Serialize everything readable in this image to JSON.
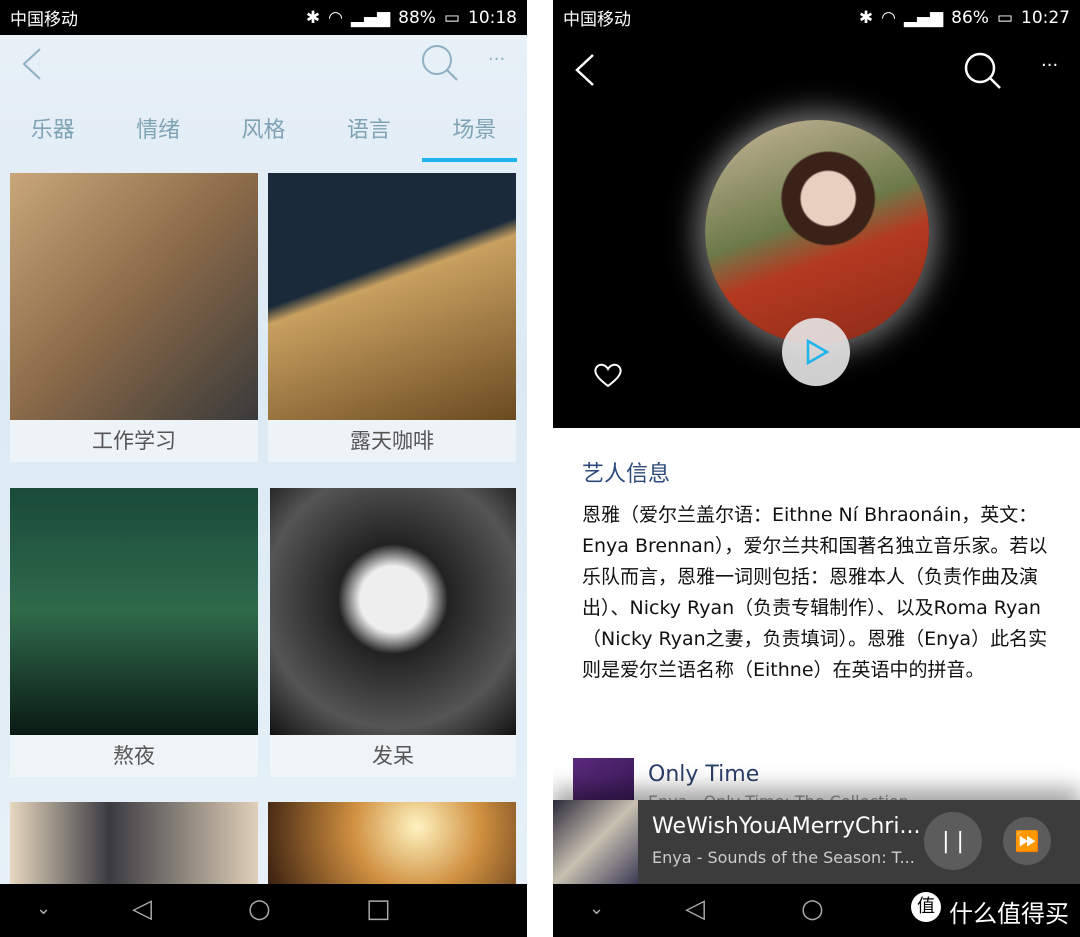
{
  "left": {
    "status": {
      "carrier": "中国移动",
      "battery": "88%",
      "time": "10:18"
    },
    "tabs": [
      {
        "label": "乐器"
      },
      {
        "label": "情绪"
      },
      {
        "label": "风格"
      },
      {
        "label": "语言"
      },
      {
        "label": "场景",
        "active": true
      }
    ],
    "tiles": [
      {
        "label": "工作学习"
      },
      {
        "label": "露天咖啡"
      },
      {
        "label": "熬夜"
      },
      {
        "label": "发呆"
      },
      {
        "label": ""
      },
      {
        "label": ""
      }
    ]
  },
  "right": {
    "status": {
      "carrier": "中国移动",
      "battery": "86%",
      "time": "10:27"
    },
    "artist_info": {
      "title": "艺人信息",
      "body": "恩雅（爱尔兰盖尔语：Eithne Ní Bhraonáin，英文：Enya Brennan），爱尔兰共和国著名独立音乐家。若以乐队而言，恩雅一词则包括：恩雅本人（负责作曲及演出）、Nicky Ryan（负责专辑制作）、以及Roma Ryan（Nicky Ryan之妻，负责填词）。恩雅（Enya）此名实则是爱尔兰语名称（Eithne）在英语中的拼音。"
    },
    "song": {
      "title": "Only Time",
      "subtitle": "Enya - Only Time: The Collection"
    },
    "mini_player": {
      "title": "WeWishYouAMerryChri...",
      "subtitle": "Enya - Sounds of the Season: T..."
    },
    "watermark": "什么值得买",
    "accent": "#1fb4ea"
  }
}
